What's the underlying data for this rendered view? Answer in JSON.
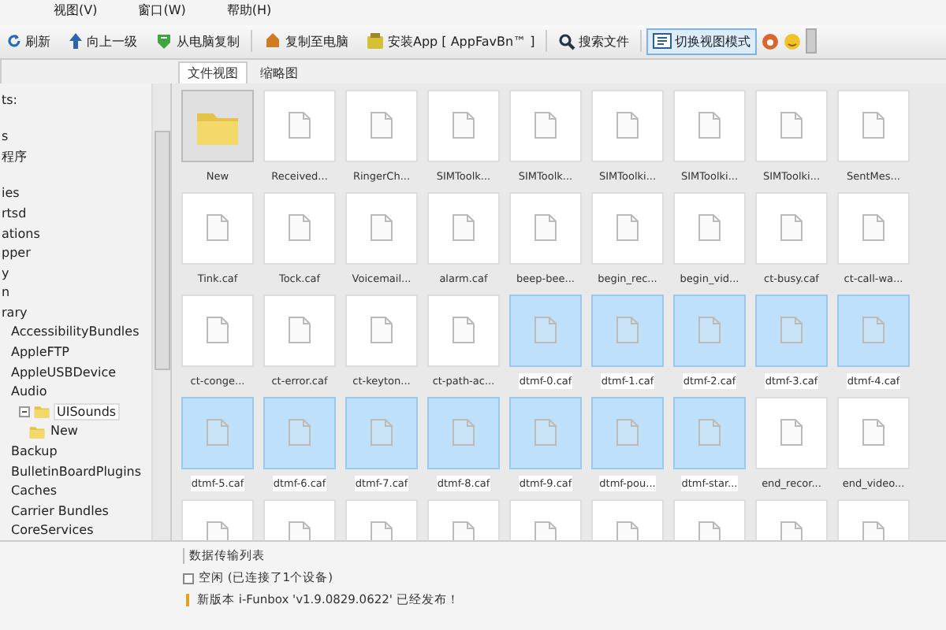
{
  "menu": [
    "视图(V)",
    "窗口(W)",
    "帮助(H)"
  ],
  "toolbar": [
    {
      "kind": "refresh",
      "label": "刷新",
      "selected": false
    },
    {
      "kind": "up",
      "label": "向上一级",
      "selected": false
    },
    {
      "kind": "import",
      "label": "从电脑复制",
      "selected": false
    },
    {
      "kind": "export",
      "label": "复制至电脑",
      "selected": false
    },
    {
      "kind": "app",
      "label": "安装App [ AppFavBn™ ]",
      "selected": false
    },
    {
      "kind": "search",
      "label": "搜索文件",
      "selected": false
    },
    {
      "kind": "view",
      "label": "切换视图模式",
      "selected": true
    }
  ],
  "view_tabs": [
    {
      "label": "文件视图",
      "selected": true
    },
    {
      "label": "缩略图",
      "selected": false
    }
  ],
  "tree": [
    {
      "label": "ts:"
    },
    {
      "label": "s"
    },
    {
      "label": "程序"
    },
    {
      "label": "ies"
    },
    {
      "label": "rtsd"
    },
    {
      "label": "ations"
    },
    {
      "label": "pper"
    },
    {
      "label": "y"
    },
    {
      "label": "n"
    },
    {
      "label": "rary",
      "children": [
        {
          "label": "AccessibilityBundles"
        },
        {
          "label": "AppleFTP"
        },
        {
          "label": "AppleUSBDevice"
        },
        {
          "label": "Audio",
          "children": [
            {
              "label": "UISounds",
              "selected": true,
              "children": [
                {
                  "label": "New",
                  "selected": false
                }
              ]
            }
          ]
        },
        {
          "label": "Backup"
        },
        {
          "label": "BulletinBoardPlugins"
        },
        {
          "label": "Caches"
        },
        {
          "label": "Carrier Bundles"
        },
        {
          "label": "CoreServices"
        }
      ]
    }
  ],
  "files": [
    {
      "kind": "folder",
      "label": "New",
      "selected": false
    },
    {
      "kind": "file",
      "label": "Received...",
      "selected": false
    },
    {
      "kind": "file",
      "label": "RingerCh...",
      "selected": false
    },
    {
      "kind": "file",
      "label": "SIMToolk...",
      "selected": false
    },
    {
      "kind": "file",
      "label": "SIMToolk...",
      "selected": false
    },
    {
      "kind": "file",
      "label": "SIMToolki...",
      "selected": false
    },
    {
      "kind": "file",
      "label": "SIMToolki...",
      "selected": false
    },
    {
      "kind": "file",
      "label": "SIMToolki...",
      "selected": false
    },
    {
      "kind": "file",
      "label": "SentMes...",
      "selected": false
    },
    {
      "kind": "file",
      "label": "Tink.caf",
      "selected": false
    },
    {
      "kind": "file",
      "label": "Tock.caf",
      "selected": false
    },
    {
      "kind": "file",
      "label": "Voicemail...",
      "selected": false
    },
    {
      "kind": "file",
      "label": "alarm.caf",
      "selected": false
    },
    {
      "kind": "file",
      "label": "beep-bee...",
      "selected": false
    },
    {
      "kind": "file",
      "label": "begin_rec...",
      "selected": false
    },
    {
      "kind": "file",
      "label": "begin_vid...",
      "selected": false
    },
    {
      "kind": "file",
      "label": "ct-busy.caf",
      "selected": false
    },
    {
      "kind": "file",
      "label": "ct-call-wa...",
      "selected": false
    },
    {
      "kind": "file",
      "label": "ct-conge...",
      "selected": false
    },
    {
      "kind": "file",
      "label": "ct-error.caf",
      "selected": false
    },
    {
      "kind": "file",
      "label": "ct-keyton...",
      "selected": false
    },
    {
      "kind": "file",
      "label": "ct-path-ac...",
      "selected": false
    },
    {
      "kind": "file",
      "label": "dtmf-0.caf",
      "selected": true
    },
    {
      "kind": "file",
      "label": "dtmf-1.caf",
      "selected": true
    },
    {
      "kind": "file",
      "label": "dtmf-2.caf",
      "selected": true
    },
    {
      "kind": "file",
      "label": "dtmf-3.caf",
      "selected": true
    },
    {
      "kind": "file",
      "label": "dtmf-4.caf",
      "selected": true
    },
    {
      "kind": "file",
      "label": "dtmf-5.caf",
      "selected": true
    },
    {
      "kind": "file",
      "label": "dtmf-6.caf",
      "selected": true
    },
    {
      "kind": "file",
      "label": "dtmf-7.caf",
      "selected": true
    },
    {
      "kind": "file",
      "label": "dtmf-8.caf",
      "selected": true
    },
    {
      "kind": "file",
      "label": "dtmf-9.caf",
      "selected": true
    },
    {
      "kind": "file",
      "label": "dtmf-pou...",
      "selected": true
    },
    {
      "kind": "file",
      "label": "dtmf-star...",
      "selected": true
    },
    {
      "kind": "file",
      "label": "end_recor...",
      "selected": false
    },
    {
      "kind": "file",
      "label": "end_video...",
      "selected": false
    },
    {
      "kind": "file",
      "selected": false
    },
    {
      "kind": "file",
      "selected": false
    },
    {
      "kind": "file",
      "selected": false
    },
    {
      "kind": "file",
      "selected": false
    },
    {
      "kind": "file",
      "selected": false
    },
    {
      "kind": "file",
      "selected": false
    },
    {
      "kind": "file",
      "selected": false
    },
    {
      "kind": "file",
      "selected": false
    },
    {
      "kind": "file",
      "selected": false
    }
  ],
  "transfer": {
    "title": "数据传输列表",
    "lines": [
      {
        "kind": "status",
        "text": "空闲 (已连接了1个设备)"
      },
      {
        "kind": "news",
        "text": "新版本 i-Funbox 'v1.9.0829.0622' 已经发布！"
      }
    ]
  }
}
